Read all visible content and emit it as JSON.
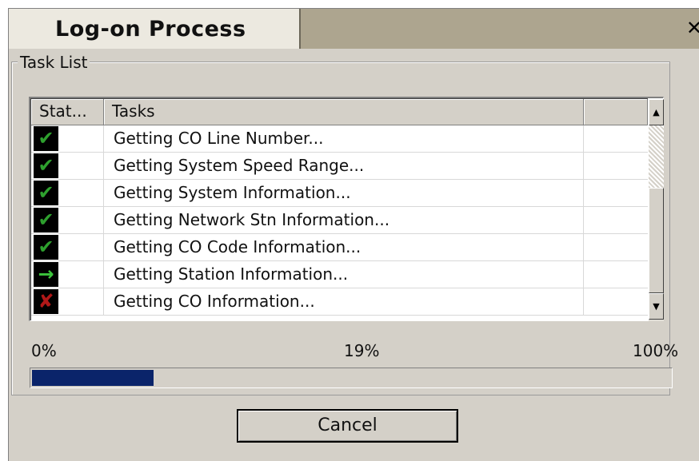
{
  "window": {
    "title": "Log-on Process",
    "close_glyph": "✕"
  },
  "group": {
    "label": "Task List"
  },
  "table": {
    "columns": [
      "Stat...",
      "Tasks",
      ""
    ],
    "rows": [
      {
        "status": "done",
        "icon": "check-icon",
        "glyph": "✔",
        "color": "#2ea02e",
        "task": "Getting CO Line Number..."
      },
      {
        "status": "done",
        "icon": "check-icon",
        "glyph": "✔",
        "color": "#2ea02e",
        "task": "Getting System Speed Range..."
      },
      {
        "status": "done",
        "icon": "check-icon",
        "glyph": "✔",
        "color": "#2ea02e",
        "task": "Getting System Information..."
      },
      {
        "status": "done",
        "icon": "check-icon",
        "glyph": "✔",
        "color": "#2ea02e",
        "task": "Getting Network Stn Information..."
      },
      {
        "status": "done",
        "icon": "check-icon",
        "glyph": "✔",
        "color": "#2ea02e",
        "task": "Getting CO Code Information..."
      },
      {
        "status": "in-progress",
        "icon": "arrow-right-icon",
        "glyph": "→",
        "color": "#3cc43c",
        "task": "Getting Station Information..."
      },
      {
        "status": "failed",
        "icon": "cross-icon",
        "glyph": "✘",
        "color": "#b01818",
        "task": "Getting CO Information..."
      }
    ]
  },
  "progress": {
    "min_label": "0%",
    "current_label": "19%",
    "max_label": "100%",
    "value": 19,
    "bar_color": "#0a246a"
  },
  "buttons": {
    "cancel_label": "Cancel"
  },
  "scrollbar": {
    "up_glyph": "▲",
    "down_glyph": "▼"
  }
}
